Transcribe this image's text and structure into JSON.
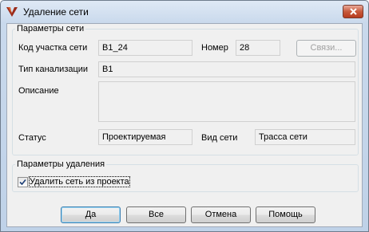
{
  "window": {
    "title": "Удаление сети"
  },
  "network_group": {
    "legend": "Параметры сети",
    "section_code_label": "Код участка сети",
    "section_code_value": "B1_24",
    "number_label": "Номер",
    "number_value": "28",
    "links_button": "Связи...",
    "sewer_type_label": "Тип канализации",
    "sewer_type_value": "B1",
    "description_label": "Описание",
    "description_value": "",
    "status_label": "Статус",
    "status_value": "Проектируемая",
    "network_type_label": "Вид сети",
    "network_type_value": "Трасса сети"
  },
  "delete_group": {
    "legend": "Параметры удаления",
    "delete_checkbox_label": "Удалить сеть из проекта",
    "delete_checked": true
  },
  "buttons": {
    "yes": "Да",
    "all": "Все",
    "cancel": "Отмена",
    "help": "Помощь"
  },
  "icons": {
    "app": "app-logo-icon",
    "close": "close-icon",
    "check": "checkmark-icon"
  }
}
